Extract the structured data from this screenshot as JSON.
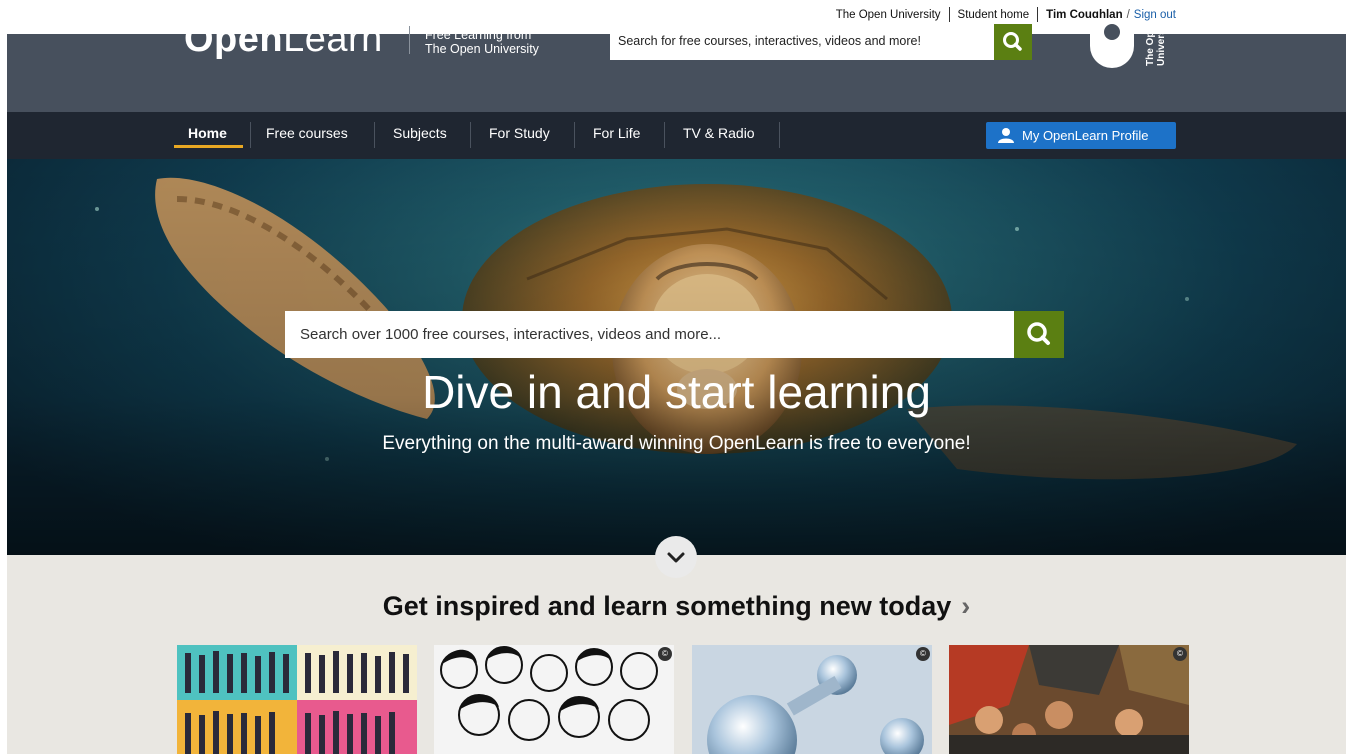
{
  "util": {
    "links": [
      "The Open University",
      "Student home"
    ],
    "user": "Tim Coughlan",
    "signout": "Sign out"
  },
  "header": {
    "logo_bold": "Open",
    "logo_light": "Learn",
    "tagline_line1": "Free Learning from",
    "tagline_line2": "The Open University",
    "search_placeholder": "Search for free courses, interactives, videos and more!",
    "ou_logo_text": "The Open University"
  },
  "nav": {
    "items": [
      "Home",
      "Free courses",
      "Subjects",
      "For Study",
      "For Life",
      "TV & Radio"
    ],
    "active": "Home",
    "profile_label": "My OpenLearn Profile"
  },
  "hero": {
    "title": "Dive in and start learning",
    "subtitle": "Everything on the multi-award winning OpenLearn is free to everyone!",
    "search_placeholder": "Search over 1000 free courses, interactives, videos and more..."
  },
  "inspire": {
    "title": "Get inspired and learn something new today",
    "chevron": "›",
    "cards": [
      {
        "name": "people-collage-image"
      },
      {
        "name": "crowd-sketch-image"
      },
      {
        "name": "glass-spheres-image"
      },
      {
        "name": "mural-painting-image"
      }
    ],
    "cc_label": "©"
  },
  "colors": {
    "header_bg": "#47505d",
    "nav_bg": "#1f2631",
    "accent_green": "#5b7f12",
    "accent_yellow": "#e8a823",
    "profile_blue": "#1d72c8"
  }
}
